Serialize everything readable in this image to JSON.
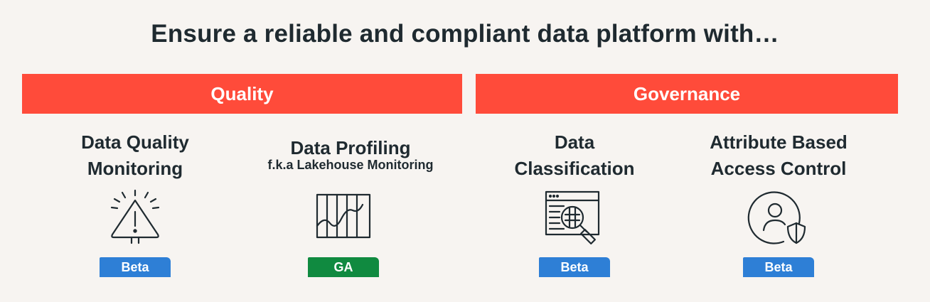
{
  "headline": "Ensure a reliable and compliant data platform with…",
  "categories": [
    {
      "label": "Quality"
    },
    {
      "label": "Governance"
    }
  ],
  "features": [
    {
      "title_line1": "Data Quality",
      "title_line2": "Monitoring",
      "icon": "warning-alert-icon",
      "badge": "Beta"
    },
    {
      "title_line1": "Data Profiling",
      "subtitle": "f.k.a Lakehouse Monitoring",
      "icon": "profiling-chart-icon",
      "badge": "GA"
    },
    {
      "title_line1": "Data",
      "title_line2": "Classification",
      "icon": "classification-search-icon",
      "badge": "Beta"
    },
    {
      "title_line1": "Attribute Based",
      "title_line2": "Access Control",
      "icon": "user-shield-icon",
      "badge": "Beta"
    }
  ],
  "colors": {
    "background": "#f7f4f1",
    "band": "#ff4b3a",
    "beta_badge": "#2e7fd6",
    "ga_badge": "#108a40",
    "text": "#1f2a30"
  }
}
